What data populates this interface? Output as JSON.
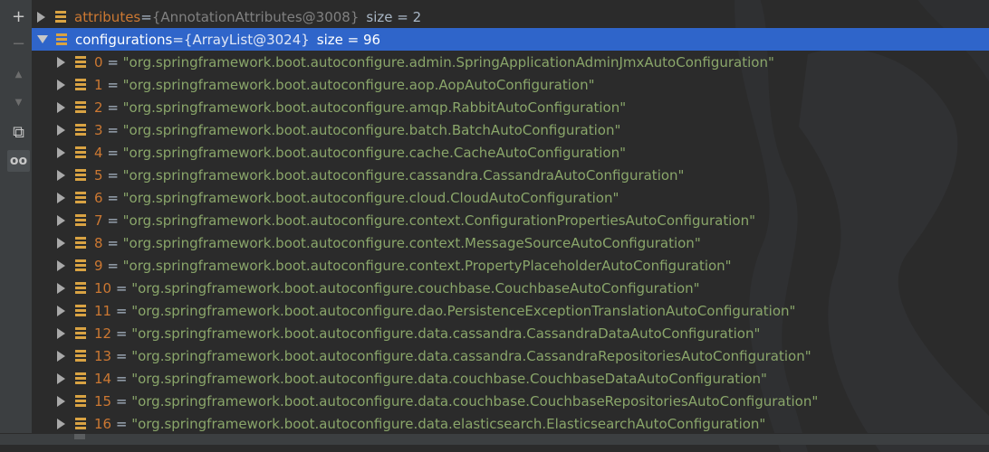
{
  "toolbar": {
    "buttons": [
      {
        "icon": "plus-icon",
        "glyph": "+"
      },
      {
        "icon": "minus-icon",
        "glyph": "−"
      },
      {
        "icon": "up-arrow-icon",
        "glyph": "▲"
      },
      {
        "icon": "down-arrow-icon",
        "glyph": "▼"
      },
      {
        "icon": "copy-icon",
        "glyph": "⧉"
      },
      {
        "icon": "glasses-icon",
        "glyph": "oo"
      }
    ]
  },
  "variables": {
    "attributes": {
      "name": "attributes",
      "eq": " = ",
      "value": "{AnnotationAttributes@3008}",
      "size": "size = 2"
    },
    "configurations": {
      "name": "configurations",
      "eq": " = ",
      "value": "{ArrayList@3024}",
      "size": "size = 96"
    },
    "items": [
      {
        "index": "0",
        "value": "\"org.springframework.boot.autoconfigure.admin.SpringApplicationAdminJmxAutoConfiguration\""
      },
      {
        "index": "1",
        "value": "\"org.springframework.boot.autoconfigure.aop.AopAutoConfiguration\""
      },
      {
        "index": "2",
        "value": "\"org.springframework.boot.autoconfigure.amqp.RabbitAutoConfiguration\""
      },
      {
        "index": "3",
        "value": "\"org.springframework.boot.autoconfigure.batch.BatchAutoConfiguration\""
      },
      {
        "index": "4",
        "value": "\"org.springframework.boot.autoconfigure.cache.CacheAutoConfiguration\""
      },
      {
        "index": "5",
        "value": "\"org.springframework.boot.autoconfigure.cassandra.CassandraAutoConfiguration\""
      },
      {
        "index": "6",
        "value": "\"org.springframework.boot.autoconfigure.cloud.CloudAutoConfiguration\""
      },
      {
        "index": "7",
        "value": "\"org.springframework.boot.autoconfigure.context.ConfigurationPropertiesAutoConfiguration\""
      },
      {
        "index": "8",
        "value": "\"org.springframework.boot.autoconfigure.context.MessageSourceAutoConfiguration\""
      },
      {
        "index": "9",
        "value": "\"org.springframework.boot.autoconfigure.context.PropertyPlaceholderAutoConfiguration\""
      },
      {
        "index": "10",
        "value": "\"org.springframework.boot.autoconfigure.couchbase.CouchbaseAutoConfiguration\""
      },
      {
        "index": "11",
        "value": "\"org.springframework.boot.autoconfigure.dao.PersistenceExceptionTranslationAutoConfiguration\""
      },
      {
        "index": "12",
        "value": "\"org.springframework.boot.autoconfigure.data.cassandra.CassandraDataAutoConfiguration\""
      },
      {
        "index": "13",
        "value": "\"org.springframework.boot.autoconfigure.data.cassandra.CassandraRepositoriesAutoConfiguration\""
      },
      {
        "index": "14",
        "value": "\"org.springframework.boot.autoconfigure.data.couchbase.CouchbaseDataAutoConfiguration\""
      },
      {
        "index": "15",
        "value": "\"org.springframework.boot.autoconfigure.data.couchbase.CouchbaseRepositoriesAutoConfiguration\""
      },
      {
        "index": "16",
        "value": "\"org.springframework.boot.autoconfigure.data.elasticsearch.ElasticsearchAutoConfiguration\""
      }
    ]
  },
  "colors": {
    "background": "#2b2b2b",
    "selection": "#2f65ca",
    "field_name": "#cc7832",
    "string_value": "#8aa66a",
    "field_icon": "#d9a343"
  }
}
